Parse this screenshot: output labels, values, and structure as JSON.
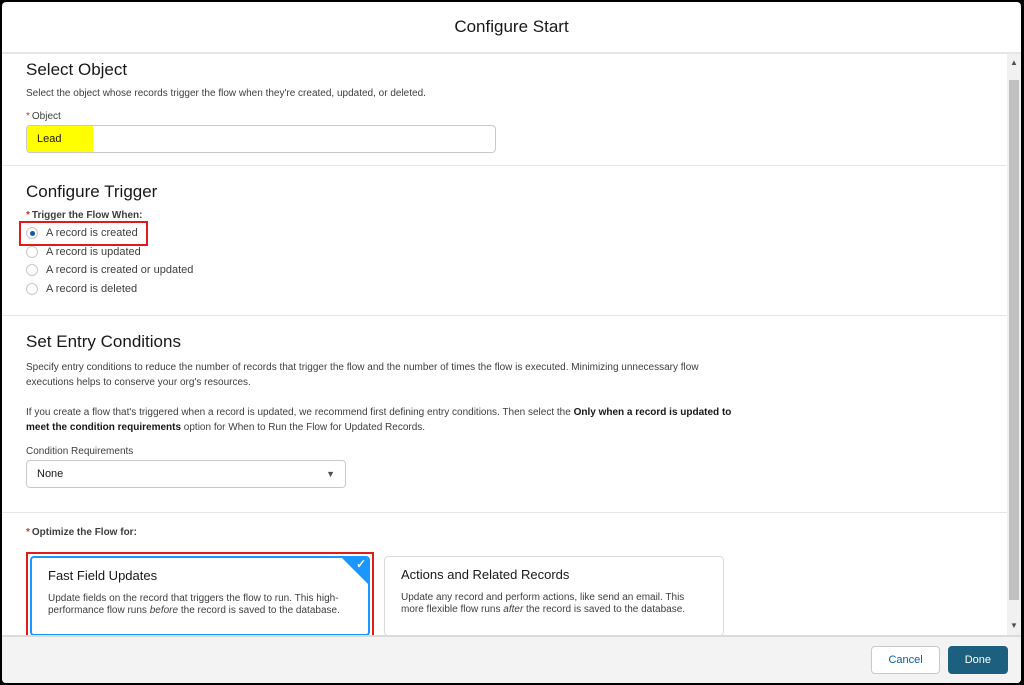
{
  "modal": {
    "title": "Configure Start"
  },
  "select_object": {
    "heading": "Select Object",
    "description": "Select the object whose records trigger the flow when they're created, updated, or deleted.",
    "field_label": "Object",
    "field_value": "Lead",
    "required_marker": "*"
  },
  "configure_trigger": {
    "heading": "Configure Trigger",
    "label": "Trigger the Flow When:",
    "required_marker": "*",
    "options": [
      {
        "label": "A record is created",
        "selected": true
      },
      {
        "label": "A record is updated",
        "selected": false
      },
      {
        "label": "A record is created or updated",
        "selected": false
      },
      {
        "label": "A record is deleted",
        "selected": false
      }
    ]
  },
  "entry_conditions": {
    "heading": "Set Entry Conditions",
    "para1": "Specify entry conditions to reduce the number of records that trigger the flow and the number of times the flow is executed. Minimizing unnecessary flow executions helps to conserve your org's resources.",
    "para2_before": "If you create a flow that's triggered when a record is updated, we recommend first defining entry conditions. Then select the ",
    "para2_bold": "Only when a record is updated to meet the condition requirements",
    "para2_after": " option for When to Run the Flow for Updated Records.",
    "condition_label": "Condition Requirements",
    "condition_value": "None"
  },
  "optimize": {
    "label": "Optimize the Flow for:",
    "required_marker": "*",
    "cards": [
      {
        "title": "Fast Field Updates",
        "text_before": "Update fields on the record that triggers the flow to run. This high-performance flow runs ",
        "text_em": "before",
        "text_after": " the record is saved to the database.",
        "selected": true
      },
      {
        "title": "Actions and Related Records",
        "text_before": "Update any record and perform actions, like send an email. This more flexible flow runs ",
        "text_em": "after",
        "text_after": " the record is saved to the database.",
        "selected": false
      }
    ]
  },
  "footer": {
    "cancel_label": "Cancel",
    "done_label": "Done"
  },
  "icons": {
    "check": "✓",
    "caret": "▼",
    "scroll_up": "▲",
    "scroll_down": "▼"
  },
  "colors": {
    "highlight": "#ffff00",
    "annotation_red": "#e01b1b",
    "selected_blue": "#1b96ff",
    "brand_button": "#1d5f7e"
  }
}
